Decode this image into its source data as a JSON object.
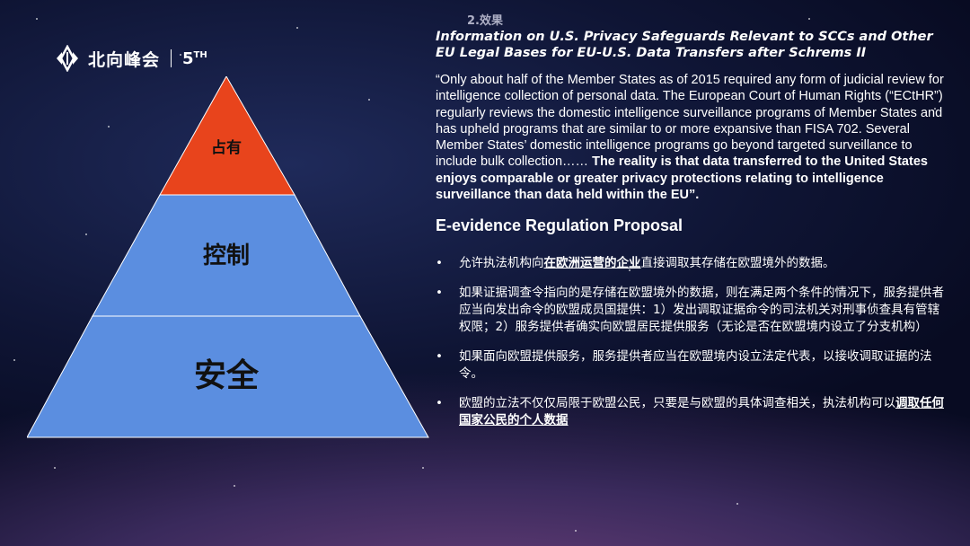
{
  "logo": {
    "brand": "北向峰会",
    "edition_number": "5",
    "edition_suffix": "TH",
    "icon": "north-wing-logo-icon"
  },
  "partial_header": "2.效果",
  "pyramid": {
    "levels": [
      {
        "label": "占有",
        "color": "#e8441c"
      },
      {
        "label": "控制",
        "color": "#5b8ee0"
      },
      {
        "label": "安全",
        "color": "#5b8ee0"
      }
    ]
  },
  "document_title": "Information on U.S. Privacy Safeguards Relevant to SCCs and Other EU Legal Bases for EU-U.S. Data Transfers after Schrems II",
  "quote": {
    "normal": "“Only about half of the Member States as of 2015 required any form of judicial review for intelligence collection of personal data. The European Court of Human Rights (“ECtHR”) regularly reviews the domestic intelligence surveillance programs of Member States and has upheld programs that are similar to or more expansive than FISA 702. Several Member States’   domestic intelligence programs go beyond targeted surveillance to include bulk collection……",
    "bold": "The reality is that data transferred to the United States enjoys comparable or greater privacy protections relating to intelligence surveillance than data held within the EU”."
  },
  "section_heading": "E-evidence Regulation Proposal",
  "points": [
    {
      "pre": "允许执法机构向",
      "emph": "在欧洲运营的企业",
      "post": "直接调取其存储在欧盟境外的数据。"
    },
    {
      "pre": "如果证据调查令指向的是存储在欧盟境外的数据，则在满足两个条件的情况下，服务提供者应当向发出命令的欧盟成员国提供：1）发出调取证据命令的司法机关对刑事侦查具有管辖权限；2）服务提供者确实向欧盟居民提供服务（无论是否在欧盟境内设立了分支机构）",
      "emph": "",
      "post": ""
    },
    {
      "pre": "如果面向欧盟提供服务，服务提供者应当在欧盟境内设立法定代表，以接收调取证据的法令。",
      "emph": "",
      "post": ""
    },
    {
      "pre": "欧盟的立法不仅仅局限于欧盟公民，只要是与欧盟的具体调查相关，执法机构可以",
      "emph": "调取任何国家公民的个人数据",
      "post": ""
    }
  ],
  "bullet_char": "•"
}
